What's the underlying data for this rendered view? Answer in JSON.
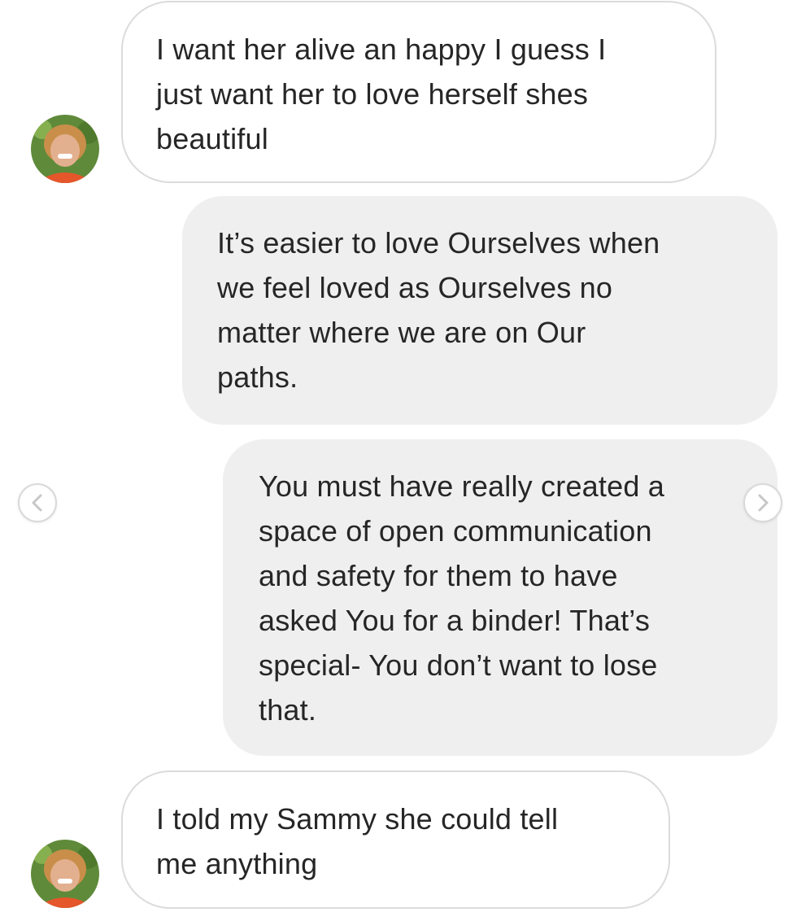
{
  "conversation": {
    "messages": [
      {
        "direction": "received",
        "text": "I want her alive an happy I guess I\njust want her to love herself shes\nbeautiful"
      },
      {
        "direction": "sent",
        "text": "It’s easier to love Ourselves when\nwe feel loved as Ourselves no\nmatter where we are on Our\npaths."
      },
      {
        "direction": "sent",
        "text": "You must have really created a\nspace of open communication\nand safety for them to have\nasked You for a binder! That’s\nspecial- You don’t want to lose\nthat."
      },
      {
        "direction": "received",
        "text": "I told my Sammy she could tell\nme anything"
      }
    ]
  },
  "carousel": {
    "prev_icon": "chevron-left-icon",
    "next_icon": "chevron-right-icon"
  },
  "colors": {
    "sent_bubble": "#efefef",
    "received_bubble_border": "#dbdbdb",
    "text": "#262626"
  }
}
